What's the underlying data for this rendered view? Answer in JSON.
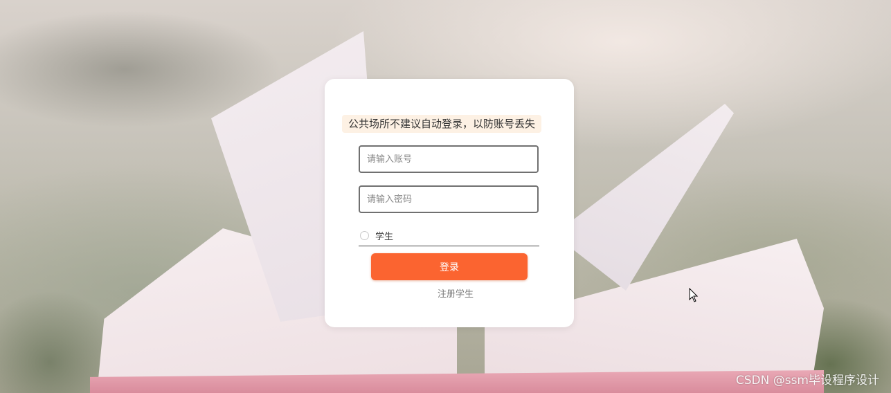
{
  "login": {
    "notice": "公共场所不建议自动登录，以防账号丢失",
    "username_placeholder": "请输入账号",
    "password_placeholder": "请输入密码",
    "role_option": "学生",
    "login_button": "登录",
    "register_link": "注册学生"
  },
  "watermark": "CSDN @ssm毕设程序设计",
  "colors": {
    "primary_button": "#fb6430",
    "notice_bg": "#fdf1e4"
  }
}
